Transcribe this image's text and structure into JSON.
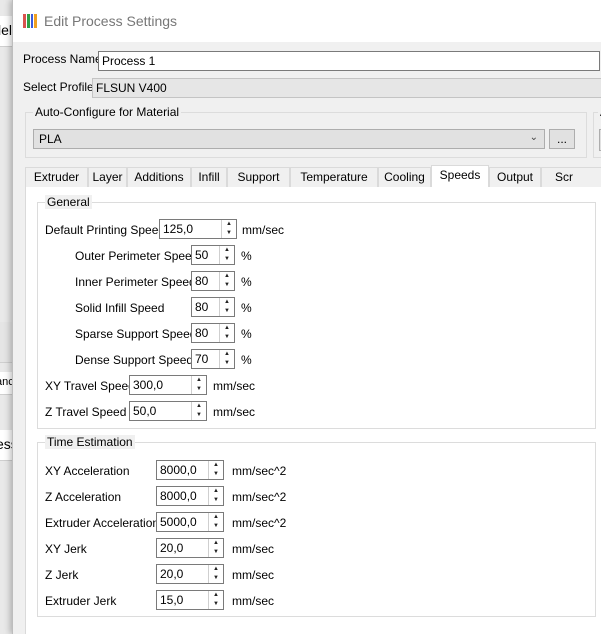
{
  "background_window": {
    "fragments": [
      "lel",
      "anc",
      "ess"
    ]
  },
  "dialog": {
    "title": "Edit Process Settings",
    "process_name_label": "Process Name",
    "process_name_value": "Process 1",
    "select_profile_label": "Select Profile",
    "select_profile_value": "FLSUN V400",
    "auto_configure_title": "Auto-Configure for Material",
    "material_value": "PLA",
    "more_button": "...",
    "right_group_fragment": "A",
    "tabs": [
      "Extruder",
      "Layer",
      "Additions",
      "Infill",
      "Support",
      "Temperature",
      "Cooling",
      "Speeds",
      "Output",
      "Scr"
    ],
    "active_tab": "Speeds",
    "general": {
      "title": "General",
      "default_speed": {
        "label": "Default Printing Speed",
        "value": "125,0",
        "unit": "mm/sec"
      },
      "outer_perimeter": {
        "label": "Outer Perimeter Speed",
        "value": "50",
        "unit": "%"
      },
      "inner_perimeter": {
        "label": "Inner Perimeter Speed",
        "value": "80",
        "unit": "%"
      },
      "solid_infill": {
        "label": "Solid Infill Speed",
        "value": "80",
        "unit": "%"
      },
      "sparse_support": {
        "label": "Sparse Support Speed",
        "value": "80",
        "unit": "%"
      },
      "dense_support": {
        "label": "Dense Support Speed",
        "value": "70",
        "unit": "%"
      },
      "xy_travel": {
        "label": "XY Travel Speed",
        "value": "300,0",
        "unit": "mm/sec"
      },
      "z_travel": {
        "label": "Z Travel Speed",
        "value": "50,0",
        "unit": "mm/sec"
      }
    },
    "time_estimation": {
      "title": "Time Estimation",
      "xy_accel": {
        "label": "XY Acceleration",
        "value": "8000,0",
        "unit": "mm/sec^2"
      },
      "z_accel": {
        "label": "Z Acceleration",
        "value": "8000,0",
        "unit": "mm/sec^2"
      },
      "ext_accel": {
        "label": "Extruder Acceleration",
        "value": "5000,0",
        "unit": "mm/sec^2"
      },
      "xy_jerk": {
        "label": "XY Jerk",
        "value": "20,0",
        "unit": "mm/sec"
      },
      "z_jerk": {
        "label": "Z Jerk",
        "value": "20,0",
        "unit": "mm/sec"
      },
      "ext_jerk": {
        "label": "Extruder Jerk",
        "value": "15,0",
        "unit": "mm/sec"
      }
    },
    "side_group_fragment": "S"
  }
}
